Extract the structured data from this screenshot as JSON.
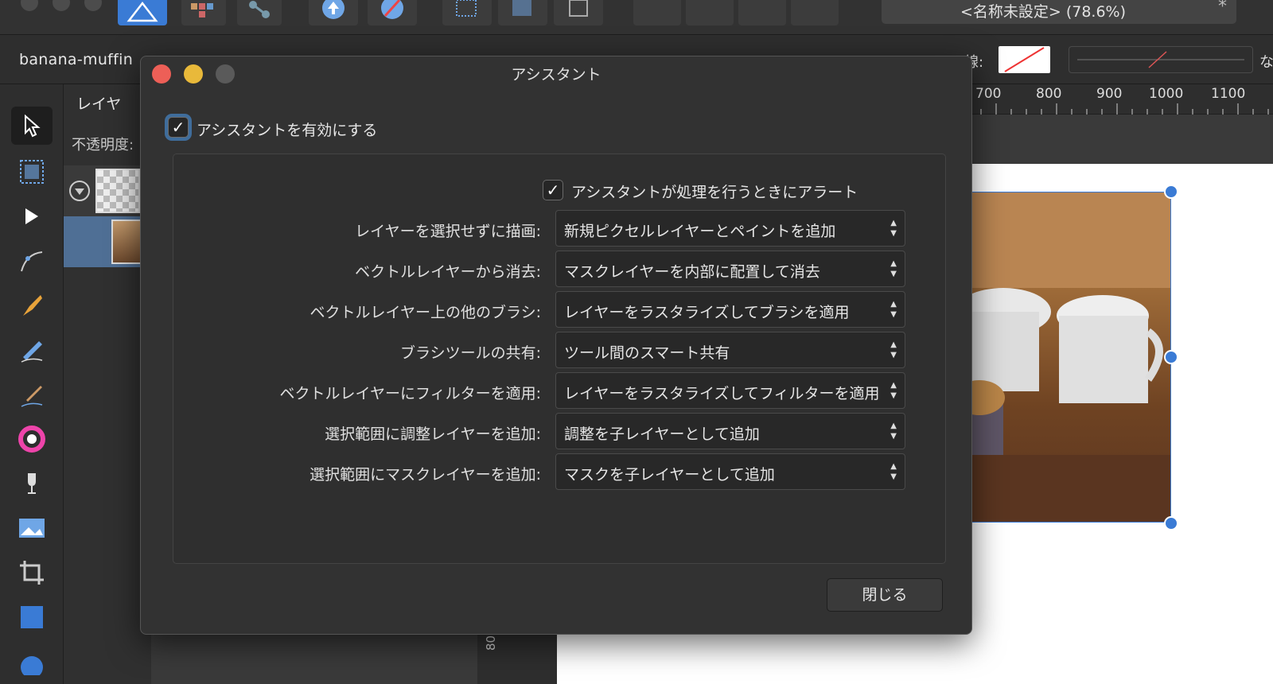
{
  "toolbar": {
    "document_title": "<名称未設定> (78.6%)",
    "modified_mark": "*"
  },
  "context_bar": {
    "document_name": "banana-muffin",
    "stroke_label": "線:",
    "stroke_none": "な"
  },
  "layers_panel": {
    "tab_label": "レイヤ",
    "opacity_label": "不透明度:"
  },
  "ruler": {
    "marks": [
      "700",
      "800",
      "900",
      "1000",
      "1100"
    ],
    "vertical_mark": "800"
  },
  "tools": [
    {
      "name": "move-tool-icon"
    },
    {
      "name": "artboard-tool-icon"
    },
    {
      "name": "node-tool-icon"
    },
    {
      "name": "pen-tool-icon"
    },
    {
      "name": "vector-brush-icon"
    },
    {
      "name": "pencil-tool-icon"
    },
    {
      "name": "paint-brush-icon"
    },
    {
      "name": "color-picker-icon"
    },
    {
      "name": "fill-tool-icon"
    },
    {
      "name": "place-image-icon"
    },
    {
      "name": "crop-tool-icon"
    },
    {
      "name": "rectangle-tool-icon"
    },
    {
      "name": "ellipse-tool-icon"
    }
  ],
  "dialog": {
    "title": "アシスタント",
    "enable_label": "アシスタントを有効にする",
    "enable_checked": true,
    "alert_label": "アシスタントが処理を行うときにアラート",
    "alert_checked": true,
    "rows": [
      {
        "label": "レイヤーを選択せずに描画:",
        "value": "新規ピクセルレイヤーとペイントを追加"
      },
      {
        "label": "ベクトルレイヤーから消去:",
        "value": "マスクレイヤーを内部に配置して消去"
      },
      {
        "label": "ベクトルレイヤー上の他のブラシ:",
        "value": "レイヤーをラスタライズしてブラシを適用"
      },
      {
        "label": "ブラシツールの共有:",
        "value": "ツール間のスマート共有"
      },
      {
        "label": "ベクトルレイヤーにフィルターを適用:",
        "value": "レイヤーをラスタライズしてフィルターを適用"
      },
      {
        "label": "選択範囲に調整レイヤーを追加:",
        "value": "調整を子レイヤーとして追加"
      },
      {
        "label": "選択範囲にマスクレイヤーを追加:",
        "value": "マスクを子レイヤーとして追加"
      }
    ],
    "close_label": "閉じる"
  },
  "colors": {
    "accent": "#3a7bd5",
    "close": "#ed5f57",
    "minimize": "#e9b93a",
    "disabled": "#5a5a5a"
  }
}
